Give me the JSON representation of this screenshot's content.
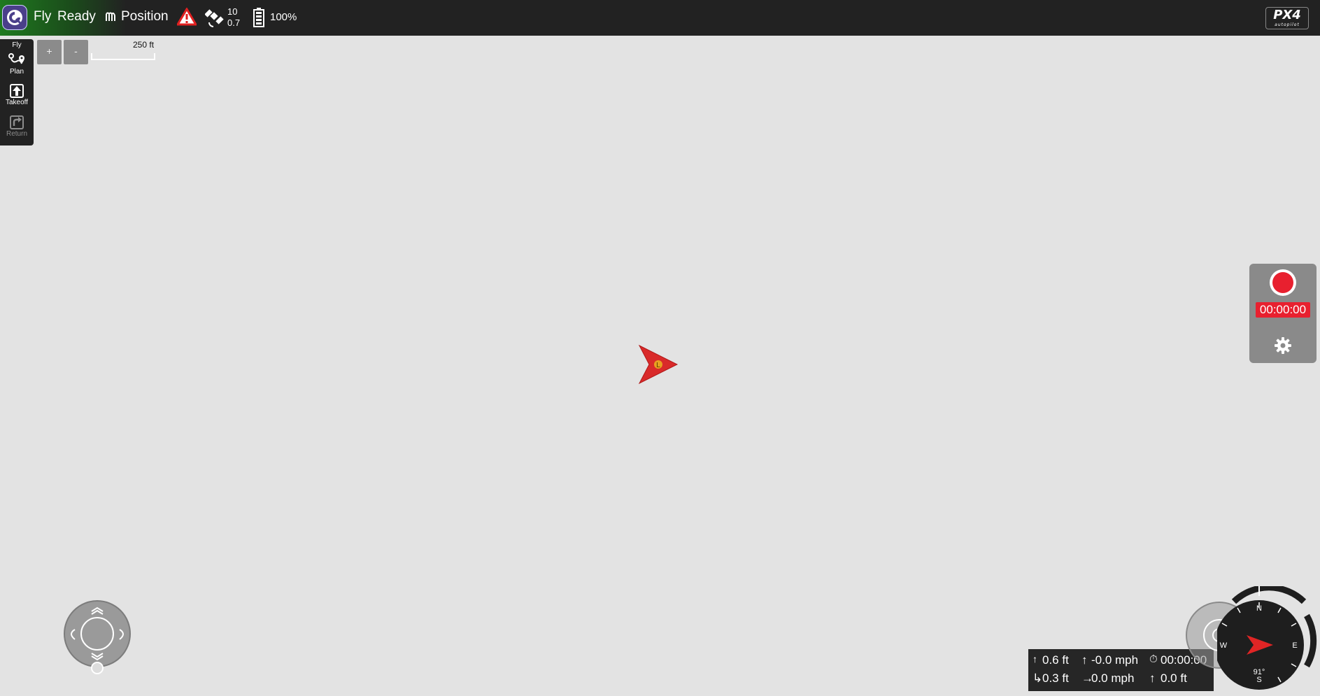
{
  "toolbar": {
    "app_name": "Fly",
    "status": "Ready",
    "flight_mode": "Position",
    "gps_satellites": "10",
    "gps_hdop": "0.7",
    "battery": "100%",
    "brand_logo": "PX4",
    "brand_sub": "autopilot"
  },
  "toolstrip": {
    "header": "Fly",
    "items": [
      {
        "label": "Plan",
        "icon": "plan-icon"
      },
      {
        "label": "Takeoff",
        "icon": "takeoff-icon"
      },
      {
        "label": "Return",
        "icon": "return-icon",
        "enabled": false
      }
    ]
  },
  "map": {
    "zoom_in": "+",
    "zoom_out": "-",
    "scale": "250 ft",
    "vehicle_label": "L"
  },
  "camera": {
    "record_time": "00:00:00",
    "settings_icon": "gear-icon"
  },
  "telemetry": {
    "altitude": "0.6 ft",
    "vertical_speed": "-0.0 mph",
    "flight_time": "00:00:00",
    "distance": "0.3 ft",
    "horizontal_speed": "0.0 mph",
    "distance_to_home": "0.0 ft"
  },
  "compass": {
    "north": "N",
    "east": "E",
    "south": "S",
    "west": "W",
    "heading": "91°"
  },
  "colors": {
    "toolbar_bg": "#222222",
    "map_bg": "#e3e3e3",
    "record_red": "#e8202f",
    "ready_green": "#1f7a1f"
  }
}
